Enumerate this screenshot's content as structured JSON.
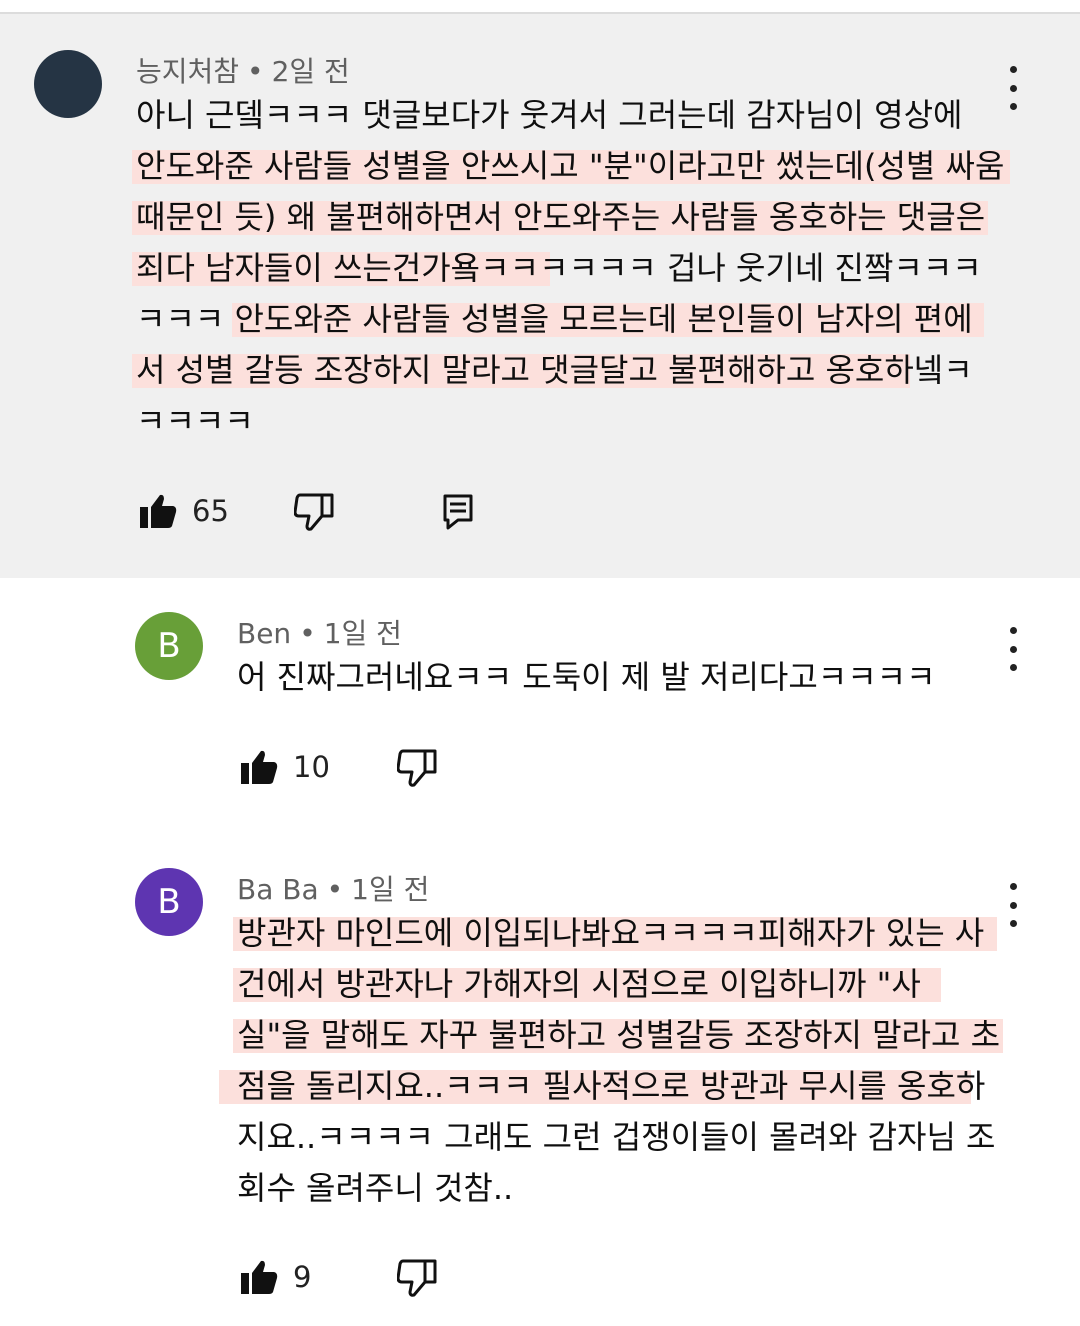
{
  "comments": [
    {
      "author": "능지처참",
      "time": "2일 전",
      "avatar_letter": "",
      "avatar_color": "#253444",
      "lines": [
        "아니 근뎈ㅋㅋㅋ 댓글보다가 웃겨서 그러는데 감자님이 영상에",
        "안도와준 사람들 성별을 안쓰시고 \"분\"이라고만 썼는데(성별 싸움",
        "때문인 듯) 왜 불편해하면서 안도와주는 사람들 옹호하는 댓글은",
        "죄다 남자들이 쓰는건가욬ㅋㅋㅋㅋㅋㅋ 겁나 웃기네 진짴ㅋㅋㅋ",
        "ㅋㅋㅋ 안도와준 사람들 성별을 모르는데 본인들이 남자의 편에",
        "서 성별 갈등 조장하지 말라고 댓글달고 불편해하고 옹호하넼ㅋ",
        "ㅋㅋㅋㅋ"
      ],
      "likes": "65",
      "show_reply_icon": true
    },
    {
      "author": "Ben",
      "time": "1일 전",
      "avatar_letter": "B",
      "avatar_color": "#689f38",
      "lines": [
        "어 진짜그러네요ㅋㅋ 도둑이 제 발 저리다고ㅋㅋㅋㅋ"
      ],
      "likes": "10",
      "show_reply_icon": false
    },
    {
      "author": "Ba Ba",
      "time": "1일 전",
      "avatar_letter": "B",
      "avatar_color": "#5e35b1",
      "lines": [
        "방관자 마인드에 이입되나봐요ㅋㅋㅋㅋ피해자가 있는 사",
        "건에서  방관자나 가해자의 시점으로 이입하니까  \"사",
        "실\"을 말해도 자꾸 불편하고 성별갈등 조장하지 말라고 초",
        "점을 돌리지요..ㅋㅋㅋ 필사적으로  방관과 무시를 옹호하",
        "지요..ㅋㅋㅋㅋ 그래도 그런 겁쟁이들이 몰려와 감자님 조",
        "회수 올려주니 것참.."
      ],
      "likes": "9",
      "show_reply_icon": false
    }
  ],
  "highlight_color": "#fce0dc"
}
